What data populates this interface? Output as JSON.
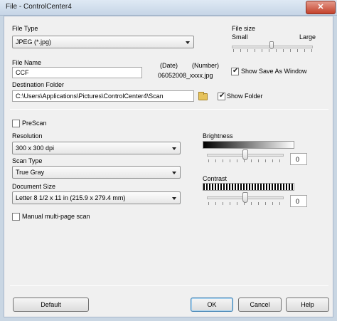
{
  "window": {
    "title": "File - ControlCenter4",
    "close_glyph": "✕"
  },
  "file_type": {
    "label": "File Type",
    "value": "JPEG (*.jpg)"
  },
  "file_size": {
    "label": "File size",
    "small": "Small",
    "large": "Large"
  },
  "file_name": {
    "label": "File Name",
    "value": "CCF"
  },
  "date": {
    "label": "(Date)",
    "value": "06052008_xxxx.jpg"
  },
  "number": {
    "label": "(Number)"
  },
  "show_save_as_window": {
    "label": "Show Save As Window",
    "checked": true
  },
  "destination": {
    "label": "Destination Folder",
    "value": "C:\\Users\\Applications\\Pictures\\ControlCenter4\\Scan",
    "icon": "folder-icon"
  },
  "show_folder": {
    "label": "Show Folder",
    "checked": true
  },
  "prescan": {
    "label": "PreScan",
    "checked": false
  },
  "resolution": {
    "label": "Resolution",
    "value": "300 x 300 dpi"
  },
  "scan_type": {
    "label": "Scan Type",
    "value": "True Gray"
  },
  "document_size": {
    "label": "Document Size",
    "value": "Letter 8 1/2 x 11 in (215.9 x 279.4 mm)"
  },
  "manual_multipage": {
    "label": "Manual multi-page scan",
    "checked": false
  },
  "brightness": {
    "label": "Brightness",
    "value": "0",
    "level_fraction": 0.5
  },
  "contrast": {
    "label": "Contrast",
    "value": "0",
    "level_fraction": 0.5
  },
  "file_size_level_fraction": 0.5,
  "buttons": {
    "default": "Default",
    "ok": "OK",
    "cancel": "Cancel",
    "help": "Help"
  }
}
